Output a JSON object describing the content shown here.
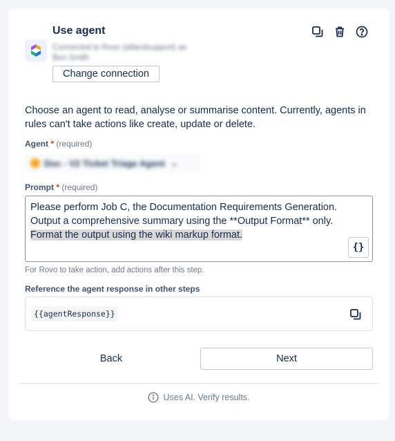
{
  "header": {
    "title": "Use agent",
    "connection_line1": "Connected to Rovo (atlandsupport) as",
    "connection_line2": "Ben Smith",
    "change_connection_label": "Change connection",
    "icons": [
      "duplicate-icon",
      "trash-icon",
      "help-icon"
    ]
  },
  "description": "Choose an agent to read, analyse or summarise content. Currently, agents in rules can't take actions like create, update or delete.",
  "agent_field": {
    "label": "Agent",
    "required_marker": "*",
    "required_text": "(required)",
    "selected_value": "Doc - V2 Ticket Triage Agent"
  },
  "prompt_field": {
    "label": "Prompt",
    "required_marker": "*",
    "required_text": "(required)",
    "line1": "Please perform Job C, the Documentation Requirements Generation.",
    "line2": "Output a comprehensive summary using the **Output Format** only.",
    "line3_highlighted": "Format the output using the wiki markup format.",
    "insert_variable_label": "{}"
  },
  "hint": "For Rovo to take action, add actions after this step.",
  "reference": {
    "label": "Reference the agent response in other steps",
    "code": "{{agentResponse}}"
  },
  "actions": {
    "back_label": "Back",
    "next_label": "Next"
  },
  "footer": {
    "text": "Uses AI. Verify results."
  },
  "colors": {
    "required": "#de350b",
    "text": "#172b4d",
    "subtle": "#6b778c",
    "highlight": "#d9d9d9"
  }
}
